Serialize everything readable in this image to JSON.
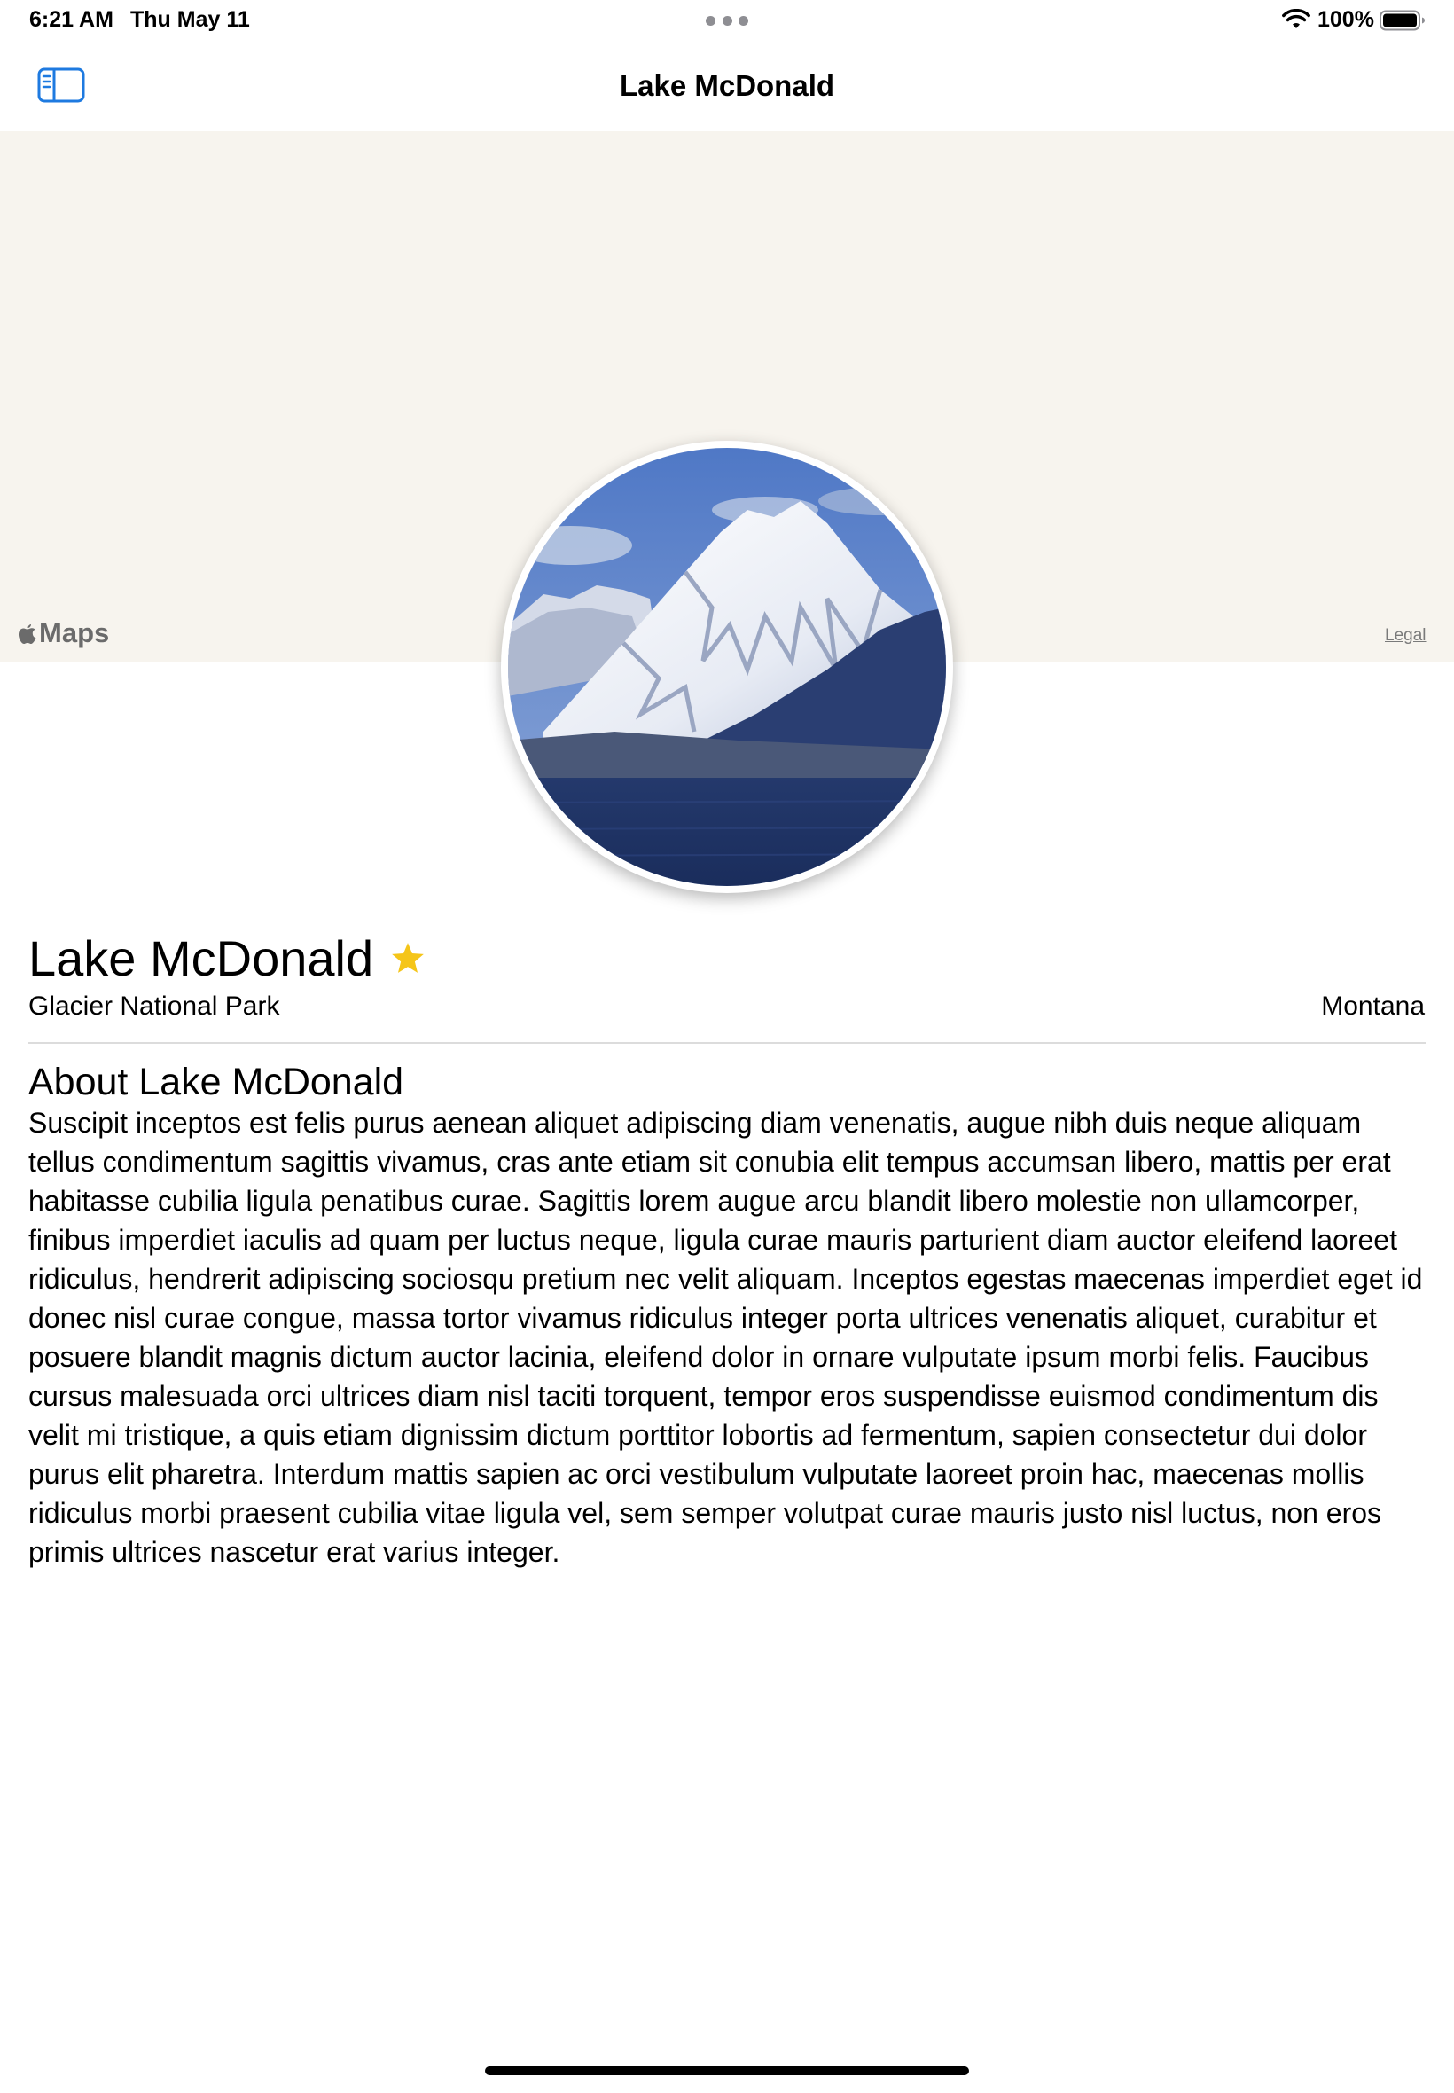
{
  "status_bar": {
    "time": "6:21 AM",
    "date": "Thu May 11",
    "battery_percent": "100%",
    "battery_level": 1.0
  },
  "nav": {
    "title": "Lake McDonald",
    "sidebar_toggle_icon": "sidebar-left-icon"
  },
  "map": {
    "brand": "Maps",
    "legal": "Legal",
    "background_color": "#f7f4ee"
  },
  "landmark": {
    "name": "Lake McDonald",
    "favorite": true,
    "favorite_color": "#f5c518",
    "park": "Glacier National Park",
    "state": "Montana",
    "about_title": "About Lake McDonald",
    "description": "Suscipit inceptos est felis purus aenean aliquet adipiscing diam venenatis, augue nibh duis neque aliquam tellus condimentum sagittis vivamus, cras ante etiam sit conubia elit tempus accumsan libero, mattis per erat habitasse cubilia ligula penatibus curae. Sagittis lorem augue arcu blandit libero molestie non ullamcorper, finibus imperdiet iaculis ad quam per luctus neque, ligula curae mauris parturient diam auctor eleifend laoreet ridiculus, hendrerit adipiscing sociosqu pretium nec velit aliquam. Inceptos egestas maecenas imperdiet eget id donec nisl curae congue, massa tortor vivamus ridiculus integer porta ultrices venenatis aliquet, curabitur et posuere blandit magnis dictum auctor lacinia, eleifend dolor in ornare vulputate ipsum morbi felis. Faucibus cursus malesuada orci ultrices diam nisl taciti torquent, tempor eros suspendisse euismod condimentum dis velit mi tristique, a quis etiam dignissim dictum porttitor lobortis ad fermentum, sapien consectetur dui dolor purus elit pharetra. Interdum mattis sapien ac orci vestibulum vulputate laoreet proin hac, maecenas mollis ridiculus morbi praesent cubilia vitae ligula vel, sem semper volutpat curae mauris justo nisl luctus, non eros primis ultrices nascetur erat varius integer."
  },
  "colors": {
    "accent": "#1e7ae0"
  }
}
